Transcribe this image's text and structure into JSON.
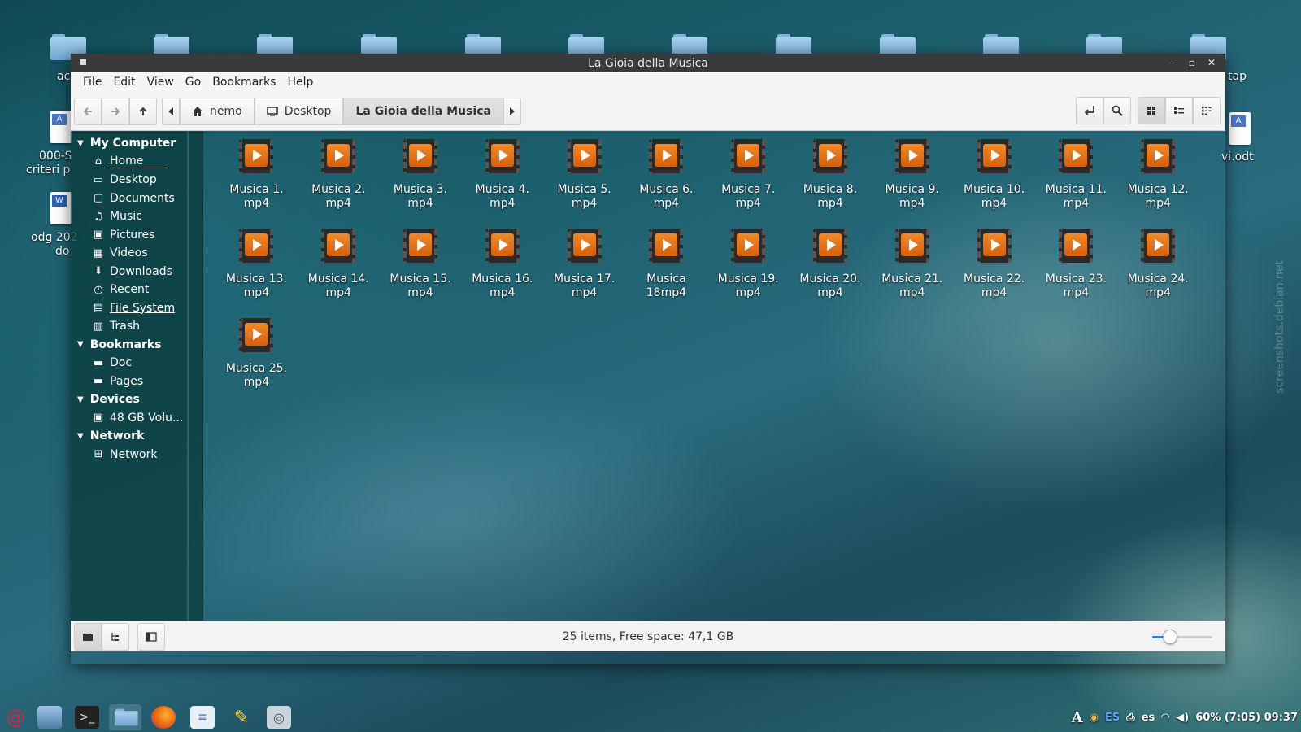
{
  "desktop": {
    "left_labels": [
      "ac",
      "000-S",
      "criteri p",
      "odg 202",
      "do"
    ],
    "right_labels": [
      "tap",
      "vi.odt"
    ]
  },
  "window": {
    "title": "La Gioia della Musica",
    "controls": {
      "minimize": "–",
      "maximize": "▫",
      "close": "✕"
    }
  },
  "menu": [
    "File",
    "Edit",
    "View",
    "Go",
    "Bookmarks",
    "Help"
  ],
  "breadcrumb": [
    {
      "label": "nemo",
      "icon": "home-icon"
    },
    {
      "label": "Desktop",
      "icon": "desktop-icon"
    },
    {
      "label": "La Gioia della Musica",
      "icon": ""
    }
  ],
  "sidebar": {
    "sections": [
      {
        "title": "My Computer",
        "items": [
          {
            "label": "Home",
            "icon": "⌂"
          },
          {
            "label": "Desktop",
            "icon": "▭"
          },
          {
            "label": "Documents",
            "icon": "▢"
          },
          {
            "label": "Music",
            "icon": "♫"
          },
          {
            "label": "Pictures",
            "icon": "▣"
          },
          {
            "label": "Videos",
            "icon": "▦"
          },
          {
            "label": "Downloads",
            "icon": "⬇"
          },
          {
            "label": "Recent",
            "icon": "◷"
          },
          {
            "label": "File System",
            "icon": "▤"
          },
          {
            "label": "Trash",
            "icon": "▥"
          }
        ]
      },
      {
        "title": "Bookmarks",
        "items": [
          {
            "label": "Doc",
            "icon": "▬"
          },
          {
            "label": "Pages",
            "icon": "▬"
          }
        ]
      },
      {
        "title": "Devices",
        "items": [
          {
            "label": "48 GB Volu...",
            "icon": "▣"
          }
        ]
      },
      {
        "title": "Network",
        "items": [
          {
            "label": "Network",
            "icon": "⊞"
          }
        ]
      }
    ]
  },
  "files": [
    "Musica 1.\nmp4",
    "Musica 2.\nmp4",
    "Musica 3.\nmp4",
    "Musica 4.\nmp4",
    "Musica 5.\nmp4",
    "Musica 6.\nmp4",
    "Musica 7.\nmp4",
    "Musica 8.\nmp4",
    "Musica 9.\nmp4",
    "Musica 10.\nmp4",
    "Musica 11.\nmp4",
    "Musica 12.\nmp4",
    "Musica 13.\nmp4",
    "Musica 14.\nmp4",
    "Musica 15.\nmp4",
    "Musica 16.\nmp4",
    "Musica 17.\nmp4",
    "Musica\n18mp4",
    "Musica 19.\nmp4",
    "Musica 20.\nmp4",
    "Musica 21.\nmp4",
    "Musica 22.\nmp4",
    "Musica 23.\nmp4",
    "Musica 24.\nmp4",
    "Musica 25.\nmp4"
  ],
  "status": {
    "text": "25 items, Free space: 47,1 GB",
    "zoom_fraction": 0.3
  },
  "tray": {
    "keyboard_layout": "ES",
    "lang": "es",
    "battery_clock": "60% (7:05) 09:37"
  },
  "colors": {
    "accent": "#3b7bd4",
    "play_orange": "#e8761c"
  },
  "watermark": "screenshots.debian.net"
}
